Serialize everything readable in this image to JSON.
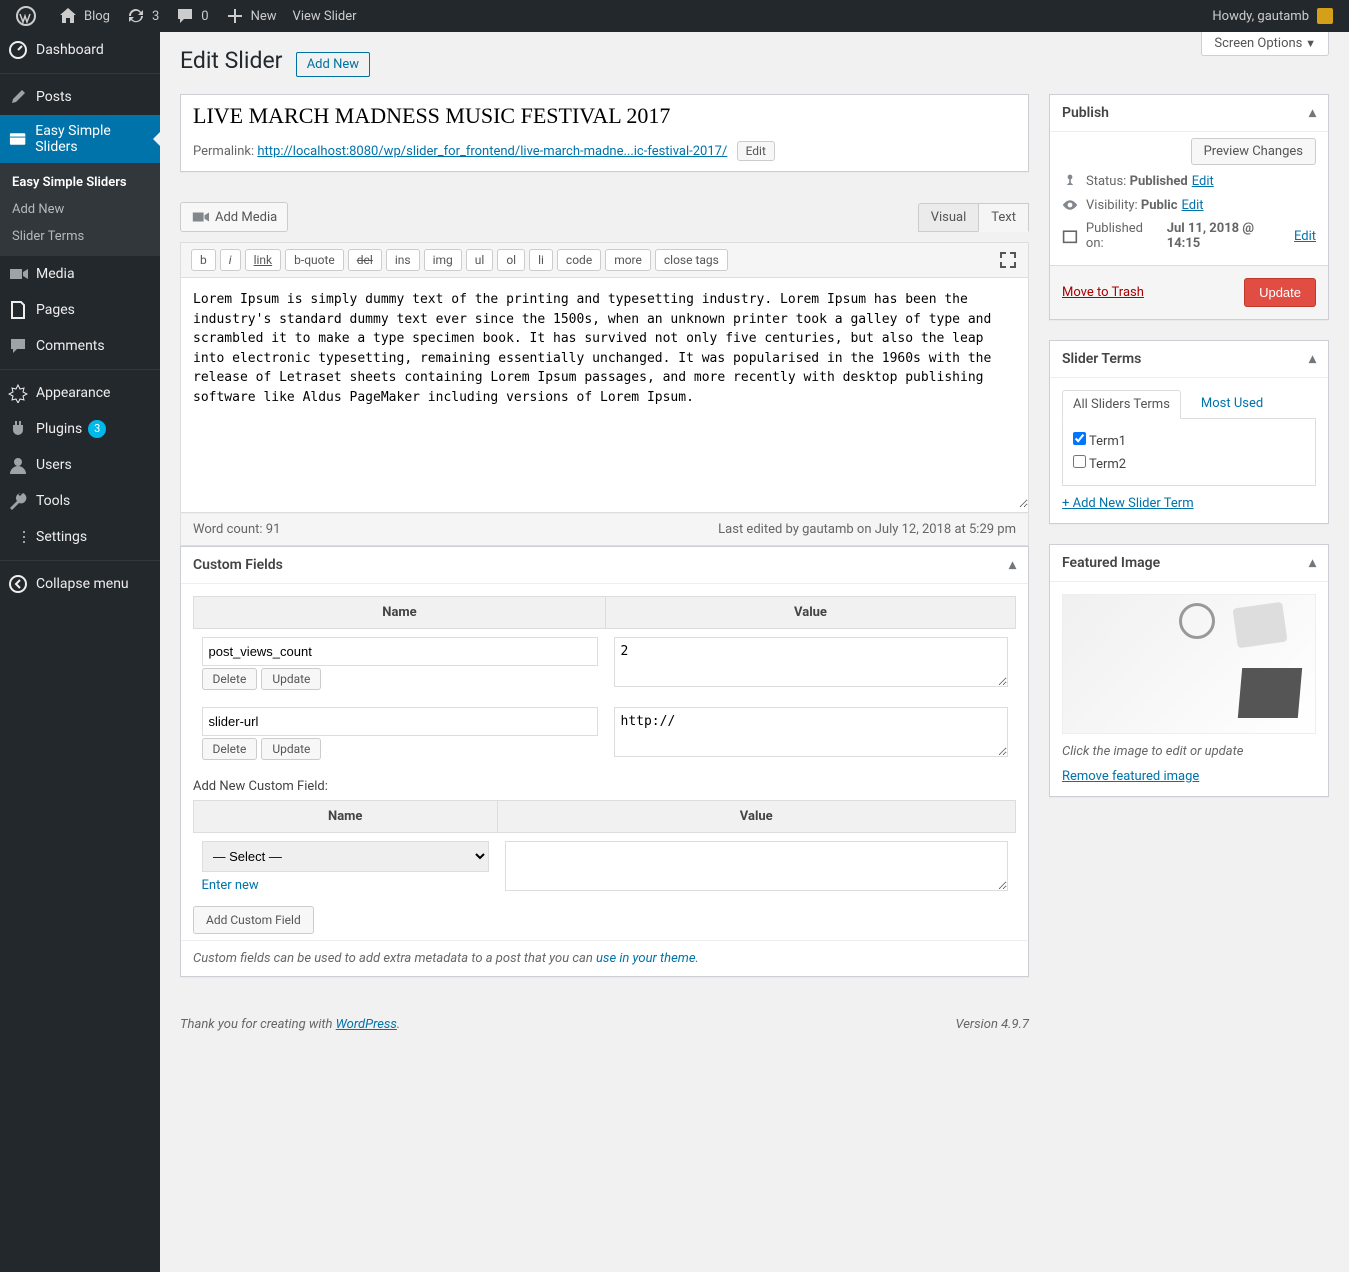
{
  "adminbar": {
    "blog": "Blog",
    "refresh": "3",
    "comments": "0",
    "new": "New",
    "view": "View Slider",
    "howdy": "Howdy, gautamb"
  },
  "sidebar": {
    "items": [
      {
        "label": "Dashboard"
      },
      {
        "label": "Posts"
      },
      {
        "label": "Easy Simple Sliders"
      },
      {
        "label": "Media"
      },
      {
        "label": "Pages"
      },
      {
        "label": "Comments"
      },
      {
        "label": "Appearance"
      },
      {
        "label": "Plugins"
      },
      {
        "label": "Users"
      },
      {
        "label": "Tools"
      },
      {
        "label": "Settings"
      },
      {
        "label": "Collapse menu"
      }
    ],
    "plugins_count": "3",
    "submenu": {
      "top": "Easy Simple Sliders",
      "add": "Add New",
      "terms": "Slider Terms"
    }
  },
  "screen_options": "Screen Options",
  "page": {
    "title": "Edit Slider",
    "add_new": "Add New"
  },
  "post": {
    "title": "LIVE MARCH MADNESS MUSIC FESTIVAL 2017",
    "permalink_label": "Permalink:",
    "permalink_base": "http://localhost:8080/wp/slider_for_frontend/",
    "permalink_slug": "live-march-madne...ic-festival-2017/",
    "edit": "Edit",
    "add_media": "Add Media",
    "tabs": {
      "visual": "Visual",
      "text": "Text"
    },
    "quicktags": [
      "b",
      "i",
      "link",
      "b-quote",
      "del",
      "ins",
      "img",
      "ul",
      "ol",
      "li",
      "code",
      "more",
      "close tags"
    ],
    "content": "Lorem Ipsum is simply dummy text of the printing and typesetting industry. Lorem Ipsum has been the industry's standard dummy text ever since the 1500s, when an unknown printer took a galley of type and scrambled it to make a type specimen book. It has survived not only five centuries, but also the leap into electronic typesetting, remaining essentially unchanged. It was popularised in the 1960s with the release of Letraset sheets containing Lorem Ipsum passages, and more recently with desktop publishing software like Aldus PageMaker including versions of Lorem Ipsum.",
    "word_count": "Word count: 91",
    "last_edited": "Last edited by gautamb on July 12, 2018 at 5:29 pm"
  },
  "custom_fields": {
    "heading": "Custom Fields",
    "cols": {
      "name": "Name",
      "value": "Value"
    },
    "rows": [
      {
        "name": "post_views_count",
        "value": "2"
      },
      {
        "name": "slider-url",
        "value": "http://"
      }
    ],
    "delete": "Delete",
    "update": "Update",
    "add_heading": "Add New Custom Field:",
    "select": "— Select —",
    "enter_new": "Enter new",
    "add_btn": "Add Custom Field",
    "note_prefix": "Custom fields can be used to add extra metadata to a post that you can ",
    "note_link": "use in your theme",
    "note_suffix": "."
  },
  "publish": {
    "heading": "Publish",
    "preview": "Preview Changes",
    "status_label": "Status:",
    "status_val": "Published",
    "status_edit": "Edit",
    "vis_label": "Visibility:",
    "vis_val": "Public",
    "vis_edit": "Edit",
    "pub_label": "Published on:",
    "pub_val": "Jul 11, 2018 @ 14:15",
    "pub_edit": "Edit",
    "trash": "Move to Trash",
    "update": "Update"
  },
  "slider_terms": {
    "heading": "Slider Terms",
    "tab_all": "All Sliders Terms",
    "tab_most": "Most Used",
    "terms": [
      {
        "label": "Term1",
        "checked": true
      },
      {
        "label": "Term2",
        "checked": false
      }
    ],
    "add": "+ Add New Slider Term"
  },
  "featured": {
    "heading": "Featured Image",
    "caption": "Click the image to edit or update",
    "remove": "Remove featured image"
  },
  "footer": {
    "thanks_prefix": "Thank you for creating with ",
    "wp": "WordPress",
    "thanks_suffix": ".",
    "version": "Version 4.9.7"
  }
}
